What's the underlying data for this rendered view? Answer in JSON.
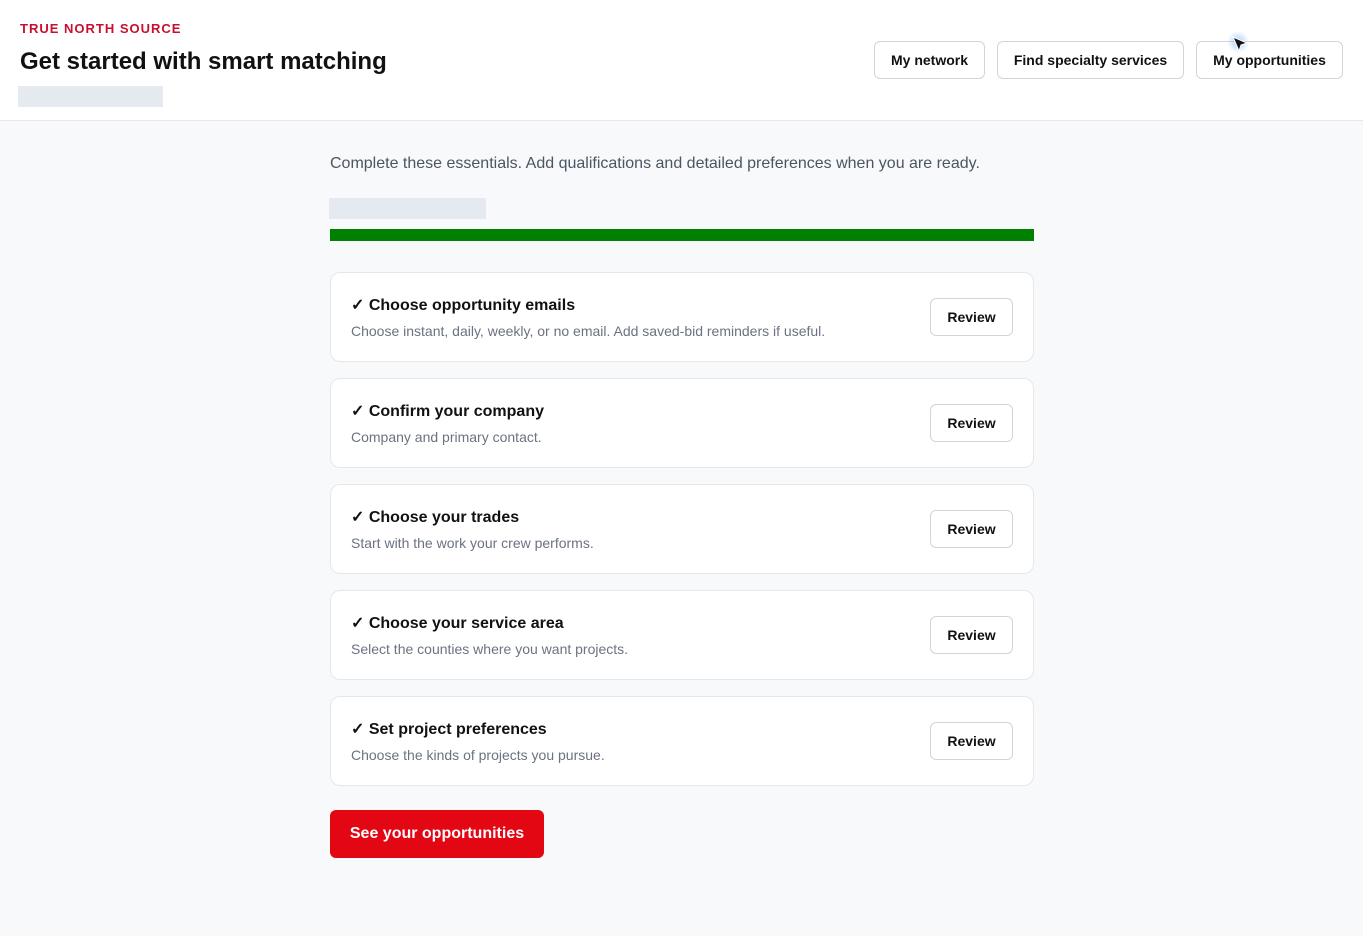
{
  "header": {
    "brand": "TRUE NORTH SOURCE",
    "title": "Get started with smart matching",
    "nav": {
      "network": "My network",
      "specialty": "Find specialty services",
      "opportunities": "My opportunities"
    }
  },
  "main": {
    "intro": "Complete these essentials. Add qualifications and detailed preferences when you are ready.",
    "progress": {
      "percent": 100,
      "color": "#008000"
    },
    "steps": [
      {
        "title": "✓ Choose opportunity emails",
        "description": "Choose instant, daily, weekly, or no email. Add saved-bid reminders if useful.",
        "action": "Review"
      },
      {
        "title": "✓ Confirm your company",
        "description": "Company and primary contact.",
        "action": "Review"
      },
      {
        "title": "✓ Choose your trades",
        "description": "Start with the work your crew performs.",
        "action": "Review"
      },
      {
        "title": "✓ Choose your service area",
        "description": "Select the counties where you want projects.",
        "action": "Review"
      },
      {
        "title": "✓ Set project preferences",
        "description": "Choose the kinds of projects you pursue.",
        "action": "Review"
      }
    ],
    "cta": "See your opportunities"
  },
  "colors": {
    "brand": "#c8102e",
    "cta": "#e30613",
    "progress": "#008000"
  }
}
